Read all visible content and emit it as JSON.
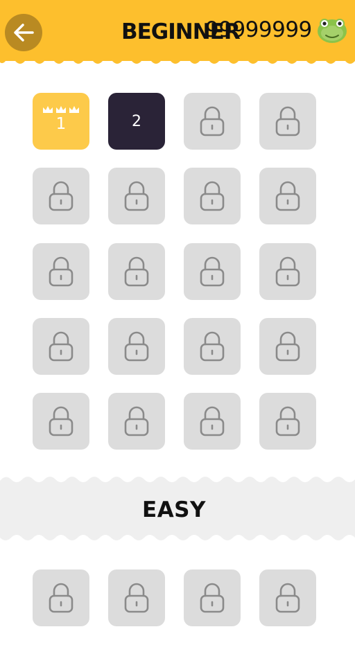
{
  "header": {
    "title": "BEGINNER",
    "coins": "99999999",
    "back_icon": "arrow-left-icon",
    "avatar_icon": "green-frog-avatar-icon",
    "color": "#fdbf2d"
  },
  "levels": [
    {
      "label": "1",
      "state": "completed",
      "stars": 3
    },
    {
      "label": "2",
      "state": "current"
    },
    {
      "state": "locked"
    },
    {
      "state": "locked"
    },
    {
      "state": "locked"
    },
    {
      "state": "locked"
    },
    {
      "state": "locked"
    },
    {
      "state": "locked"
    },
    {
      "state": "locked"
    },
    {
      "state": "locked"
    },
    {
      "state": "locked"
    },
    {
      "state": "locked"
    },
    {
      "state": "locked"
    },
    {
      "state": "locked"
    },
    {
      "state": "locked"
    },
    {
      "state": "locked"
    },
    {
      "state": "locked"
    },
    {
      "state": "locked"
    },
    {
      "state": "locked"
    },
    {
      "state": "locked"
    }
  ],
  "section": {
    "title": "EASY",
    "levels": [
      {
        "state": "locked"
      },
      {
        "state": "locked"
      },
      {
        "state": "locked"
      },
      {
        "state": "locked"
      }
    ]
  },
  "icons": {
    "locked": "lock-icon",
    "stars": "crown-icon"
  },
  "colors": {
    "completed": "#fdca4a",
    "current": "#2a2337",
    "locked": "#dcdcdc",
    "lock_stroke": "#8a8a8a",
    "section_band": "#efefef"
  }
}
